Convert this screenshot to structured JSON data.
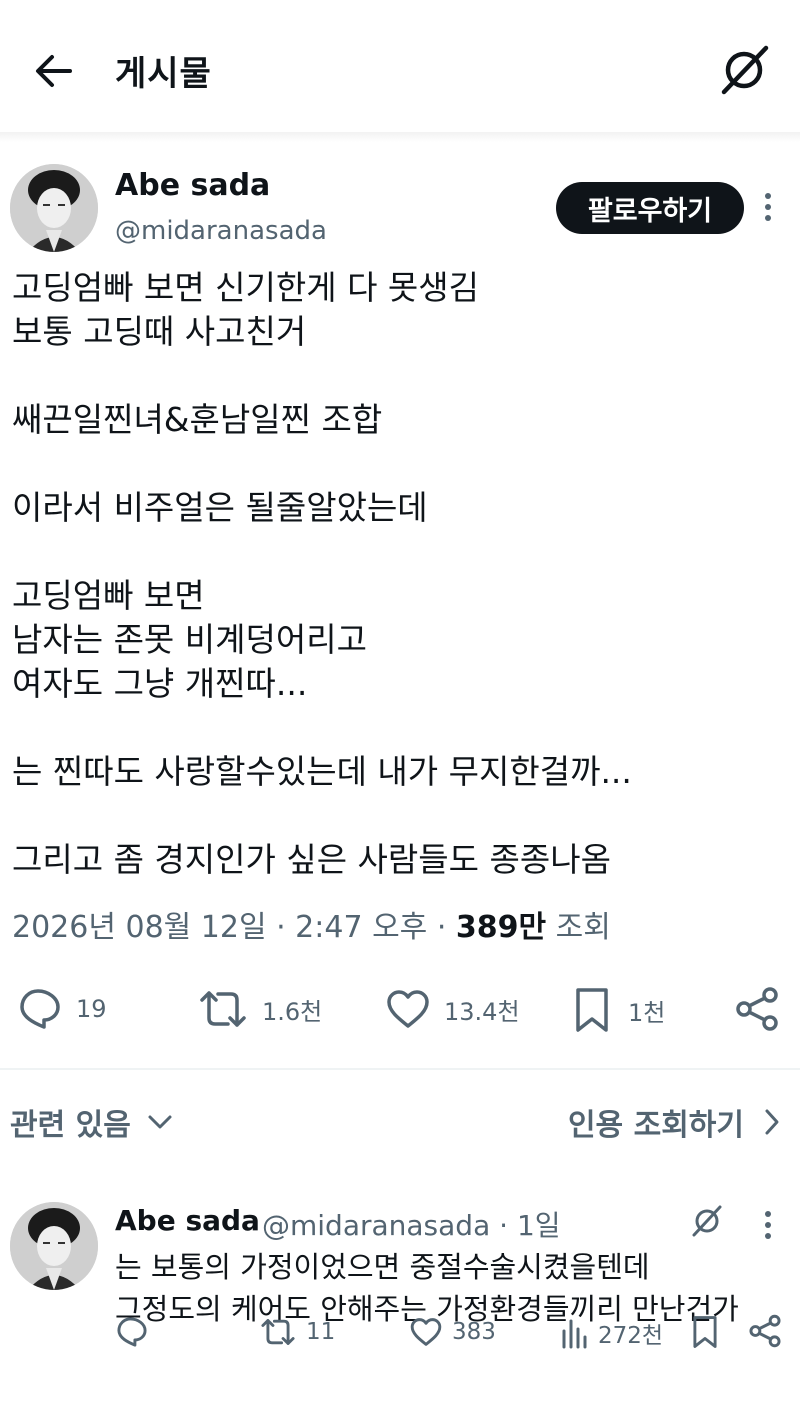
{
  "header": {
    "title": "게시물",
    "back_icon": "arrow-left-icon",
    "grok_icon": "grok-icon"
  },
  "post": {
    "author_name": "Abe sada",
    "author_handle": "@midaranasada",
    "follow_label": "팔로우하기",
    "text": "고딩엄빠 보면 신기한게 다 못생김\n보통 고딩때 사고친거\n\n쌔끈일찐녀&훈남일찐 조합\n\n이라서 비주얼은 될줄알았는데\n\n고딩엄빠 보면\n남자는 존못 비계덩어리고\n여자도 그냥 개찐따...\n\n는 찐따도 사랑할수있는데 내가 무지한걸까...\n\n그리고 좀 경지인가 싶은 사람들도 종종나옴",
    "timestamp": "2026년 08월 12일 · 2:47 오후 · ",
    "views_count": "389만",
    "views_label": " 조회",
    "actions": {
      "replies": "19",
      "reposts": "1.6천",
      "likes": "13.4천",
      "bookmarks": "1천"
    }
  },
  "related": {
    "label": "관련 있음",
    "quote_label": "인용 조회하기"
  },
  "reply": {
    "author_name": "Abe sada",
    "author_handle": "@midaranasada · 1일",
    "text": "는 보통의 가정이었으면 중절수술시켰을텐데\n그정도의 케어도 안해주는 가정환경들끼리 만난건가",
    "actions": {
      "replies": "",
      "reposts": "11",
      "likes": "383",
      "views": "272천"
    }
  },
  "colors": {
    "text": "#0f1419",
    "secondary": "#536471",
    "button_bg": "#0f1419",
    "divider": "#eff3f4"
  }
}
